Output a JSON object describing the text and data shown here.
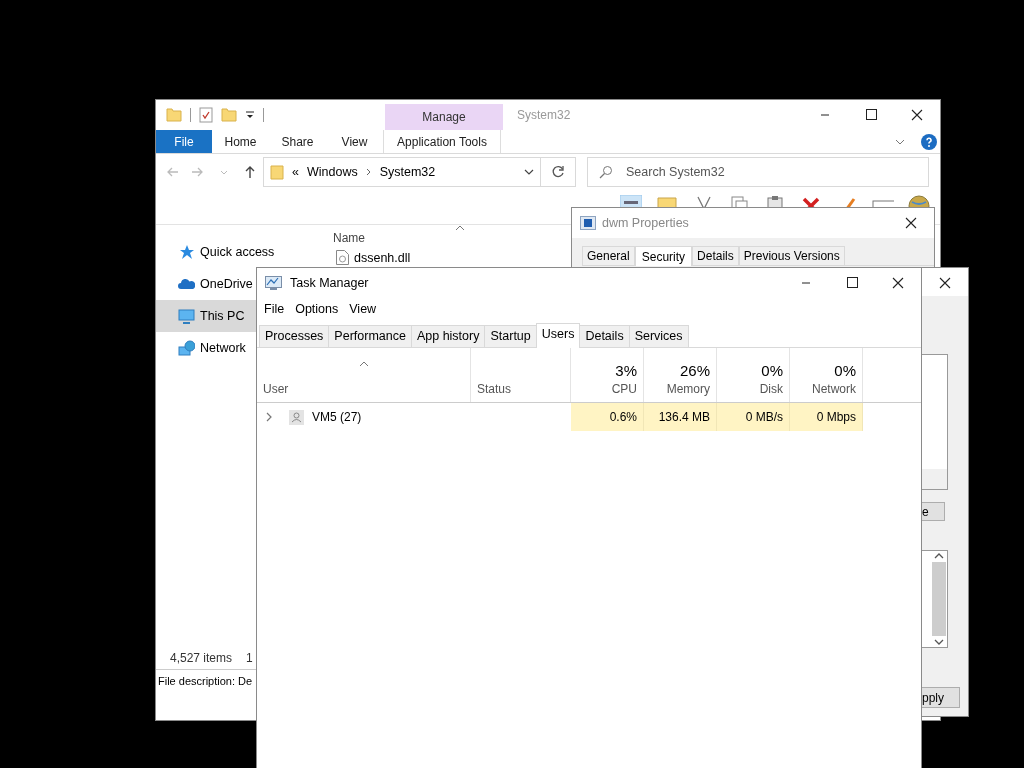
{
  "explorer": {
    "context_group": "Manage",
    "title": "System32",
    "ribbon_tabs": [
      {
        "label": "File",
        "kind": "file"
      },
      {
        "label": "Home",
        "kind": "plain"
      },
      {
        "label": "Share",
        "kind": "plain"
      },
      {
        "label": "View",
        "kind": "plain"
      },
      {
        "label": "Application Tools",
        "kind": "context"
      }
    ],
    "address": {
      "overflow": "«",
      "crumbs": [
        "Windows",
        "System32"
      ]
    },
    "search": {
      "placeholder": "Search System32"
    },
    "nav": [
      {
        "label": "Quick access",
        "kind": "star",
        "selected": false
      },
      {
        "label": "OneDrive",
        "kind": "cloud",
        "selected": false
      },
      {
        "label": "This PC",
        "kind": "pc",
        "selected": true
      },
      {
        "label": "Network",
        "kind": "network",
        "selected": false
      }
    ],
    "column_header": "Name",
    "files": [
      "dssenh.dll"
    ],
    "status": {
      "count": "4,527 items",
      "column_2": "1"
    },
    "details_bar": "File description: De"
  },
  "properties_back": {
    "title": "dwm Properties",
    "tabs": [
      {
        "label": "General",
        "selected": false
      },
      {
        "label": "Security",
        "selected": true
      },
      {
        "label": "Details",
        "selected": false
      },
      {
        "label": "Previous Versions",
        "selected": false
      }
    ]
  },
  "properties_front": {
    "buttons": [
      "e",
      "pply"
    ]
  },
  "task_manager": {
    "title": "Task Manager",
    "menu": [
      "File",
      "Options",
      "View"
    ],
    "tabs": [
      {
        "label": "Processes",
        "selected": false
      },
      {
        "label": "Performance",
        "selected": false
      },
      {
        "label": "App history",
        "selected": false
      },
      {
        "label": "Startup",
        "selected": false
      },
      {
        "label": "Users",
        "selected": true
      },
      {
        "label": "Details",
        "selected": false
      },
      {
        "label": "Services",
        "selected": false
      }
    ],
    "columns": [
      {
        "label": "User",
        "kind": "text"
      },
      {
        "label": "Status",
        "kind": "text"
      },
      {
        "label": "CPU",
        "kind": "metric",
        "total": "3%"
      },
      {
        "label": "Memory",
        "kind": "metric",
        "total": "26%"
      },
      {
        "label": "Disk",
        "kind": "metric",
        "total": "0%"
      },
      {
        "label": "Network",
        "kind": "metric",
        "total": "0%"
      }
    ],
    "rows": [
      {
        "user": "VM5 (27)",
        "expanded": false,
        "values": [
          "0.6%",
          "136.4 MB",
          "0 MB/s",
          "0 Mbps"
        ]
      }
    ]
  }
}
